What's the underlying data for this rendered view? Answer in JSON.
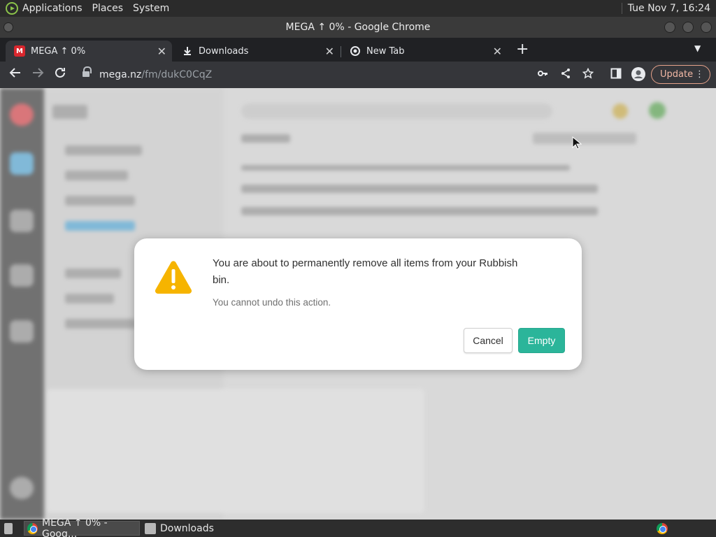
{
  "system_panel": {
    "menus": [
      "Applications",
      "Places",
      "System"
    ],
    "clock": "Tue Nov  7, 16:24"
  },
  "window": {
    "title": "MEGA ↑ 0% - Google Chrome"
  },
  "tabs": [
    {
      "label": "MEGA ↑ 0%",
      "favicon": "mega-icon",
      "active": true
    },
    {
      "label": "Downloads",
      "favicon": "download-icon",
      "active": false
    },
    {
      "label": "New Tab",
      "favicon": "chrome-icon",
      "active": false
    }
  ],
  "toolbar": {
    "url_host": "mega.nz",
    "url_path": "/fm/dukC0CqZ",
    "update_label": "Update"
  },
  "dialog": {
    "title": "You are about to permanently remove all items from your Rubbish bin.",
    "subtitle": "You cannot undo this action.",
    "cancel_label": "Cancel",
    "confirm_label": "Empty",
    "confirm_color": "#2bb59a",
    "icon": "warning-icon"
  },
  "taskbar": {
    "items": [
      {
        "label": "MEGA ↑ 0% - Goog...",
        "icon": "chrome-icon",
        "active": true
      },
      {
        "label": "Downloads",
        "icon": "folder-icon",
        "active": false
      }
    ]
  }
}
